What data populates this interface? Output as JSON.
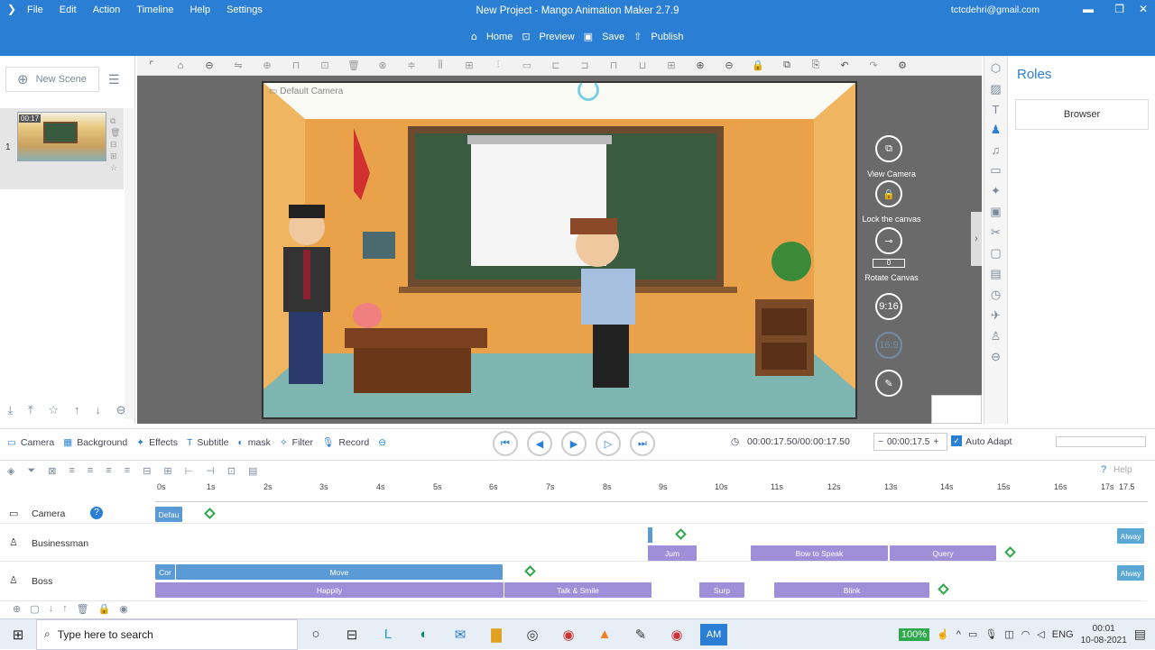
{
  "menu": [
    "File",
    "Edit",
    "Action",
    "Timeline",
    "Help",
    "Settings"
  ],
  "window": {
    "title": "New Project - Mango Animation Maker 2.7.9",
    "email": "tctcdehri@gmail.com"
  },
  "nav": {
    "home": "Home",
    "preview": "Preview",
    "save": "Save",
    "publish": "Publish"
  },
  "scene": {
    "new_scene": "New Scene",
    "number": "1",
    "duration": "00:17"
  },
  "camera_label": "Default Camera",
  "canvas_controls": {
    "view_camera": "View Camera",
    "lock_canvas": "Lock the canvas",
    "rotate": "Rotate Canvas",
    "rotate_value": "0",
    "ratio1": "9:16",
    "ratio2": "16:9"
  },
  "roles": {
    "title": "Roles",
    "browser": "Browser"
  },
  "bottombar": {
    "camera": "Camera",
    "background": "Background",
    "effects": "Effects",
    "subtitle": "Subtitle",
    "mask": "mask",
    "filter": "Filter",
    "record": "Record",
    "time": "00:00:17.50/00:00:17.50",
    "time_input": "00:00:17.5",
    "auto_adapt": "Auto Adapt"
  },
  "help": "Help",
  "ruler": [
    "0s",
    "1s",
    "2s",
    "3s",
    "4s",
    "5s",
    "6s",
    "7s",
    "8s",
    "9s",
    "10s",
    "11s",
    "12s",
    "13s",
    "14s",
    "15s",
    "16s",
    "17s",
    "17.5"
  ],
  "tracks": {
    "camera": {
      "name": "Camera",
      "clip": "Defau"
    },
    "businessman": {
      "name": "Businessman",
      "clips": [
        "Jum",
        "Bow to Speak",
        "Query"
      ],
      "always": "Alway"
    },
    "boss": {
      "name": "Boss",
      "clips": [
        "Cor",
        "Move",
        "Happily",
        "Talk & Smile",
        "Surp",
        "Blink"
      ],
      "always": "Alway"
    }
  },
  "taskbar": {
    "search": "Type here to search",
    "zoom": "100%",
    "lang": "ENG",
    "time": "00:01",
    "date": "10-08-2021",
    "am_label": "AM"
  },
  "colors": {
    "titlebar": "#2a7fd4",
    "clip_blue": "#5b9bd5",
    "clip_purple": "#9f8fd8",
    "keyframe": "#2da84a"
  }
}
